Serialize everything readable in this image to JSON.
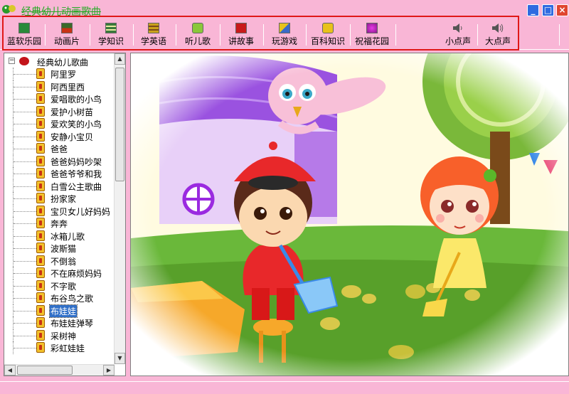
{
  "window": {
    "title": "经典幼儿动画歌曲",
    "controls": {
      "minimize": "_",
      "maximize": "□",
      "close": "×"
    }
  },
  "toolbar": {
    "items": [
      {
        "label": "蓝软乐园",
        "icon": "home-icon",
        "color": "#2a8a3a"
      },
      {
        "label": "动画片",
        "icon": "film-icon",
        "color": "#3a6a2a"
      },
      {
        "label": "学知识",
        "icon": "book-icon",
        "color": "#3a7a3a"
      },
      {
        "label": "学英语",
        "icon": "english-icon",
        "color": "#caa21a"
      },
      {
        "label": "听儿歌",
        "icon": "smiley-icon",
        "color": "#8ac83a"
      },
      {
        "label": "讲故事",
        "icon": "story-icon",
        "color": "#c81a1a"
      },
      {
        "label": "玩游戏",
        "icon": "game-icon",
        "color": "#caa21a"
      },
      {
        "label": "百科知识",
        "icon": "face-icon",
        "color": "#e8c21a"
      },
      {
        "label": "祝福花园",
        "icon": "flower-icon",
        "color": "#b02ab0"
      },
      {
        "label": "小点声",
        "icon": "volume-down-icon",
        "color": "#555555"
      },
      {
        "label": "大点声",
        "icon": "volume-up-icon",
        "color": "#555555"
      }
    ]
  },
  "tree": {
    "root_label": "经典幼儿歌曲",
    "toggle": "−",
    "selected_index": 19,
    "songs": [
      "阿里罗",
      "阿西里西",
      "爱唱歌的小鸟",
      "爱护小树苗",
      "爱欢笑的小鸟",
      "安静小宝贝",
      "爸爸",
      "爸爸妈妈吵架",
      "爸爸爷爷和我",
      "白雪公主歌曲",
      "扮家家",
      "宝贝女儿好妈妈",
      "奔奔",
      "冰箱儿歌",
      "波斯猫",
      "不倒翁",
      "不在麻烦妈妈",
      "不字歌",
      "布谷鸟之歌",
      "布娃娃",
      "布娃娃弹琴",
      "采树神",
      "彩虹娃娃"
    ]
  },
  "scrollbars": {
    "up": "▲",
    "down": "▼",
    "left": "◀",
    "right": "▶"
  },
  "colors": {
    "window_bg": "#f9b6d6",
    "highlight_border": "#e01818",
    "selection": "#3170c8"
  }
}
